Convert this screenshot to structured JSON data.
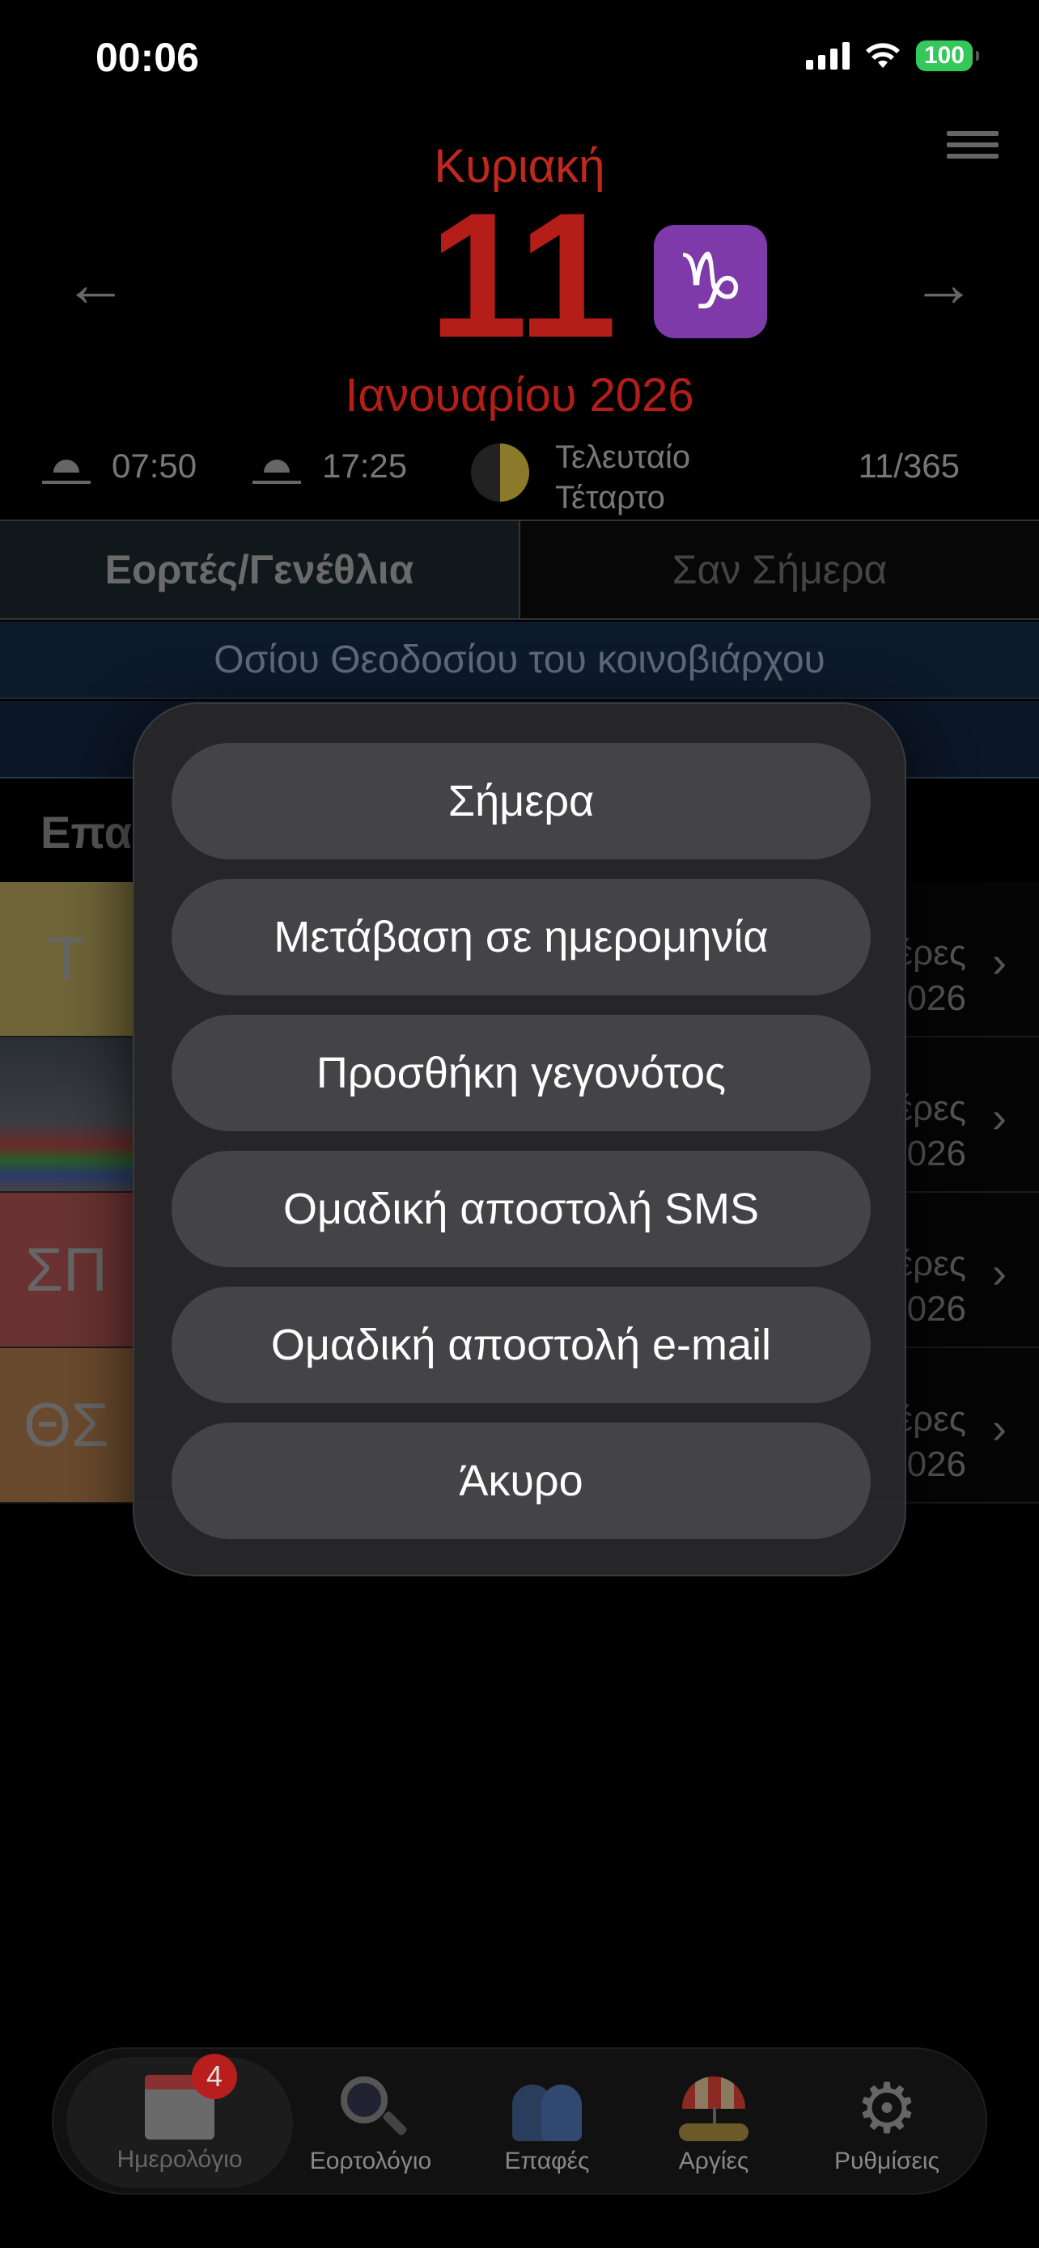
{
  "status_bar": {
    "time": "00:06",
    "battery": "100"
  },
  "header": {
    "weekday": "Κυριακή",
    "day": "11",
    "zodiac_symbol": "♑",
    "month_year": "Ιανουαρίου 2026",
    "sunrise": "07:50",
    "sunset": "17:25",
    "moon_phase_line1": "Τελευταίο",
    "moon_phase_line2": "Τέταρτο",
    "day_of_year": "11/365"
  },
  "tabs": {
    "active": "Εορτές/Γενέθλια",
    "inactive": "Σαν Σήμερα"
  },
  "saint_of_day": "Οσίου Θεοδοσίου του κοινοβιάρχου",
  "section_title": "Επα",
  "contacts": [
    {
      "initials": "Τ",
      "line1": "έρες",
      "line2": "026"
    },
    {
      "initials": "",
      "line1": "έρες",
      "line2": "026"
    },
    {
      "initials": "ΣΠ",
      "line1": "έρες",
      "line2": "026"
    },
    {
      "initials": "ΘΣ",
      "line1": "έρες",
      "line2": "026"
    }
  ],
  "action_sheet": {
    "today": "Σήμερα",
    "goto_date": "Μετάβαση σε ημερομηνία",
    "add_event": "Προσθήκη γεγονότος",
    "group_sms": "Ομαδική αποστολή SMS",
    "group_email": "Ομαδική αποστολή e-mail",
    "cancel": "Άκυρο"
  },
  "tab_bar": {
    "calendar": "Ημερολόγιο",
    "calendar_badge": "4",
    "nameday_calendar": "Εορτολόγιο",
    "contacts": "Επαφές",
    "holidays": "Αργίες",
    "settings": "Ρυθμίσεις"
  },
  "colors": {
    "accent_red": "#b51e18",
    "zodiac_purple": "#7d3aa8",
    "battery_green": "#34c759"
  }
}
